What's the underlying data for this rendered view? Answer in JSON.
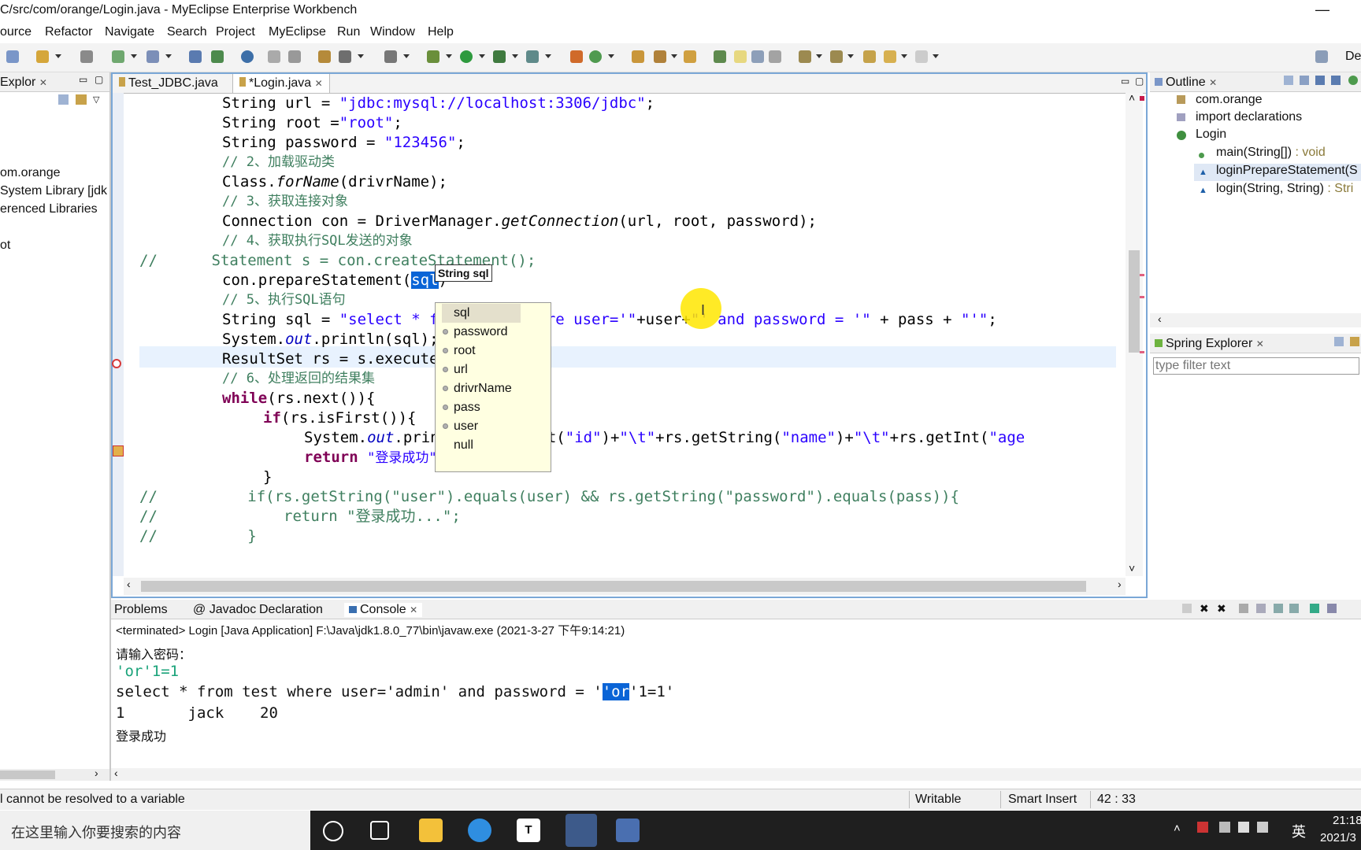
{
  "window": {
    "title": "C/src/com/orange/Login.java - MyEclipse Enterprise Workbench",
    "minimize": "—"
  },
  "menu": [
    "ource",
    "Refactor",
    "Navigate",
    "Search",
    "Project",
    "MyEclipse",
    "Run",
    "Window",
    "Help"
  ],
  "toolbar": {
    "perspective_label": "De"
  },
  "explorer": {
    "tab_title": "Explor",
    "items": [
      "om.orange",
      "System Library [jdk",
      "erenced Libraries",
      "ot"
    ]
  },
  "editor": {
    "tabs": [
      {
        "label": "Test_JDBC.java"
      },
      {
        "label": "*Login.java"
      }
    ]
  },
  "code": {
    "l1a": "String url = ",
    "l1b": "\"jdbc:mysql://localhost:3306/jdbc\"",
    "l1c": ";",
    "l2a": "String root =",
    "l2b": "\"root\"",
    "l2c": ";",
    "l3a": "String password = ",
    "l3b": "\"123456\"",
    "l3c": ";",
    "l4": "// 2、加载驱动类",
    "l5a": "Class.",
    "l5b": "forName",
    "l5c": "(drivrName);",
    "l6": "// 3、获取连接对象",
    "l7a": "Connection con = DriverManager.",
    "l7b": "getConnection",
    "l7c": "(url, root, password);",
    "l8": "// 4、获取执行SQL发送的对象",
    "l9": "//      Statement s = con.createStatement();",
    "l10a": "con.prepareStatement(",
    "l10b": "sql",
    "l10c": ")",
    "l11": "// 5、执行SQL语句",
    "l12a": "String sql = ",
    "l12b": "\"select * from test where user='\"",
    "l12c": "+user+",
    "l12d": "\"' and password = '\"",
    "l12e": " + pass + ",
    "l12f": "\"'\"",
    "l12g": ";",
    "l13a": "System.",
    "l13b": "out",
    "l13c": ".println(sql);",
    "l14": "ResultSet rs = s.executeQuery(sql);",
    "l15": "// 6、处理返回的结果集",
    "l16a": "while",
    "l16b": "(rs.next()){",
    "l17a": "if",
    "l17b": "(rs.isFirst()){",
    "l18a": "System.",
    "l18b": "out",
    "l18c": ".println(rs.getInt(",
    "l18d": "\"id\"",
    "l18e": ")+",
    "l18f": "\"\\t\"",
    "l18g": "+rs.getString(",
    "l18h": "\"name\"",
    "l18i": ")+",
    "l18j": "\"\\t\"",
    "l18k": "+rs.getInt(",
    "l18l": "\"age",
    "l19a": "return ",
    "l19b": "\"登录成功\"",
    "l19c": ";",
    "l20": "}",
    "l21a": "//          if(rs.getString(",
    "l21b": "\"user\"",
    "l21c": ").equals(user) && rs.getString(",
    "l21d": "\"password\"",
    "l21e": ").equals(pass)){",
    "l22a": "//              return ",
    "l22b": "\"登录成功...\"",
    "l22c": ";",
    "l23": "//          }"
  },
  "tooltip": "String sql",
  "proposals": [
    "sql",
    "password",
    "root",
    "url",
    "drivrName",
    "pass",
    "user",
    "null"
  ],
  "outline": {
    "tab_title": "Outline",
    "items": [
      "com.orange",
      "import declarations",
      "Login",
      "main(String[])",
      " : void",
      "loginPrepareStatement(S",
      "login(String, String)",
      " : Stri"
    ]
  },
  "spring": {
    "tab_title": "Spring Explorer",
    "filter_placeholder": "type filter text"
  },
  "console": {
    "tabs": [
      "Problems",
      "Javadoc",
      "Declaration",
      "Console"
    ],
    "header": "<terminated> Login [Java Application] F:\\Java\\jdk1.8.0_77\\bin\\javaw.exe (2021-3-27 下午9:14:21)",
    "lines": {
      "prompt": "请输入密码：",
      "input": "'or'1=1",
      "q1": "select * from test where user='admin' and password = '",
      "q2": "'or",
      "q3": "'1=1'",
      "row": "1       jack    20",
      "result": "登录成功"
    }
  },
  "status": {
    "message": "l cannot be resolved to a variable",
    "writable": "Writable",
    "insert": "Smart Insert",
    "position": "42 : 33"
  },
  "taskbar": {
    "search_placeholder": "在这里输入你要搜索的内容",
    "ime": "英",
    "time": "21:18",
    "date": "2021/3"
  },
  "colors": {
    "keyword": "#7f0055",
    "string": "#2a00ff",
    "comment": "#3f7f5f",
    "selection": "#0a64d6",
    "highlight": "#ffe600"
  }
}
